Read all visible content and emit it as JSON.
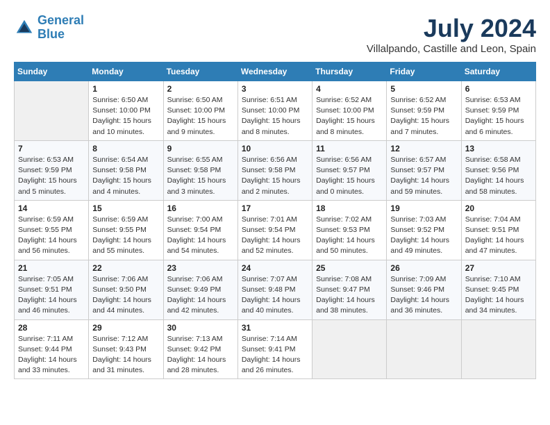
{
  "header": {
    "logo_line1": "General",
    "logo_line2": "Blue",
    "month": "July 2024",
    "location": "Villalpando, Castille and Leon, Spain"
  },
  "weekdays": [
    "Sunday",
    "Monday",
    "Tuesday",
    "Wednesday",
    "Thursday",
    "Friday",
    "Saturday"
  ],
  "weeks": [
    [
      {
        "day": "",
        "detail": ""
      },
      {
        "day": "1",
        "detail": "Sunrise: 6:50 AM\nSunset: 10:00 PM\nDaylight: 15 hours\nand 10 minutes."
      },
      {
        "day": "2",
        "detail": "Sunrise: 6:50 AM\nSunset: 10:00 PM\nDaylight: 15 hours\nand 9 minutes."
      },
      {
        "day": "3",
        "detail": "Sunrise: 6:51 AM\nSunset: 10:00 PM\nDaylight: 15 hours\nand 8 minutes."
      },
      {
        "day": "4",
        "detail": "Sunrise: 6:52 AM\nSunset: 10:00 PM\nDaylight: 15 hours\nand 8 minutes."
      },
      {
        "day": "5",
        "detail": "Sunrise: 6:52 AM\nSunset: 9:59 PM\nDaylight: 15 hours\nand 7 minutes."
      },
      {
        "day": "6",
        "detail": "Sunrise: 6:53 AM\nSunset: 9:59 PM\nDaylight: 15 hours\nand 6 minutes."
      }
    ],
    [
      {
        "day": "7",
        "detail": "Sunrise: 6:53 AM\nSunset: 9:59 PM\nDaylight: 15 hours\nand 5 minutes."
      },
      {
        "day": "8",
        "detail": "Sunrise: 6:54 AM\nSunset: 9:58 PM\nDaylight: 15 hours\nand 4 minutes."
      },
      {
        "day": "9",
        "detail": "Sunrise: 6:55 AM\nSunset: 9:58 PM\nDaylight: 15 hours\nand 3 minutes."
      },
      {
        "day": "10",
        "detail": "Sunrise: 6:56 AM\nSunset: 9:58 PM\nDaylight: 15 hours\nand 2 minutes."
      },
      {
        "day": "11",
        "detail": "Sunrise: 6:56 AM\nSunset: 9:57 PM\nDaylight: 15 hours\nand 0 minutes."
      },
      {
        "day": "12",
        "detail": "Sunrise: 6:57 AM\nSunset: 9:57 PM\nDaylight: 14 hours\nand 59 minutes."
      },
      {
        "day": "13",
        "detail": "Sunrise: 6:58 AM\nSunset: 9:56 PM\nDaylight: 14 hours\nand 58 minutes."
      }
    ],
    [
      {
        "day": "14",
        "detail": "Sunrise: 6:59 AM\nSunset: 9:55 PM\nDaylight: 14 hours\nand 56 minutes."
      },
      {
        "day": "15",
        "detail": "Sunrise: 6:59 AM\nSunset: 9:55 PM\nDaylight: 14 hours\nand 55 minutes."
      },
      {
        "day": "16",
        "detail": "Sunrise: 7:00 AM\nSunset: 9:54 PM\nDaylight: 14 hours\nand 54 minutes."
      },
      {
        "day": "17",
        "detail": "Sunrise: 7:01 AM\nSunset: 9:54 PM\nDaylight: 14 hours\nand 52 minutes."
      },
      {
        "day": "18",
        "detail": "Sunrise: 7:02 AM\nSunset: 9:53 PM\nDaylight: 14 hours\nand 50 minutes."
      },
      {
        "day": "19",
        "detail": "Sunrise: 7:03 AM\nSunset: 9:52 PM\nDaylight: 14 hours\nand 49 minutes."
      },
      {
        "day": "20",
        "detail": "Sunrise: 7:04 AM\nSunset: 9:51 PM\nDaylight: 14 hours\nand 47 minutes."
      }
    ],
    [
      {
        "day": "21",
        "detail": "Sunrise: 7:05 AM\nSunset: 9:51 PM\nDaylight: 14 hours\nand 46 minutes."
      },
      {
        "day": "22",
        "detail": "Sunrise: 7:06 AM\nSunset: 9:50 PM\nDaylight: 14 hours\nand 44 minutes."
      },
      {
        "day": "23",
        "detail": "Sunrise: 7:06 AM\nSunset: 9:49 PM\nDaylight: 14 hours\nand 42 minutes."
      },
      {
        "day": "24",
        "detail": "Sunrise: 7:07 AM\nSunset: 9:48 PM\nDaylight: 14 hours\nand 40 minutes."
      },
      {
        "day": "25",
        "detail": "Sunrise: 7:08 AM\nSunset: 9:47 PM\nDaylight: 14 hours\nand 38 minutes."
      },
      {
        "day": "26",
        "detail": "Sunrise: 7:09 AM\nSunset: 9:46 PM\nDaylight: 14 hours\nand 36 minutes."
      },
      {
        "day": "27",
        "detail": "Sunrise: 7:10 AM\nSunset: 9:45 PM\nDaylight: 14 hours\nand 34 minutes."
      }
    ],
    [
      {
        "day": "28",
        "detail": "Sunrise: 7:11 AM\nSunset: 9:44 PM\nDaylight: 14 hours\nand 33 minutes."
      },
      {
        "day": "29",
        "detail": "Sunrise: 7:12 AM\nSunset: 9:43 PM\nDaylight: 14 hours\nand 31 minutes."
      },
      {
        "day": "30",
        "detail": "Sunrise: 7:13 AM\nSunset: 9:42 PM\nDaylight: 14 hours\nand 28 minutes."
      },
      {
        "day": "31",
        "detail": "Sunrise: 7:14 AM\nSunset: 9:41 PM\nDaylight: 14 hours\nand 26 minutes."
      },
      {
        "day": "",
        "detail": ""
      },
      {
        "day": "",
        "detail": ""
      },
      {
        "day": "",
        "detail": ""
      }
    ]
  ]
}
